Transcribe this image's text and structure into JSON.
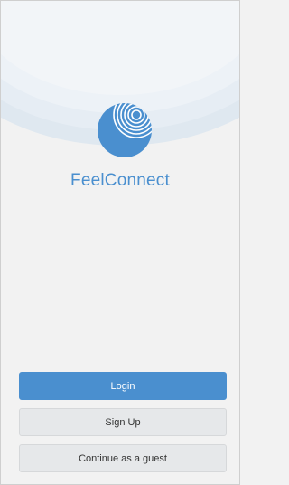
{
  "app": {
    "name": "FeelConnect",
    "logo_icon": "spiral-sphere-logo-icon"
  },
  "actions": {
    "login_label": "Login",
    "signup_label": "Sign Up",
    "guest_label": "Continue as a guest"
  },
  "colors": {
    "accent": "#4a8fcf",
    "background": "#f2f2f2",
    "secondary_button": "#e6e8ea",
    "text": "#333333"
  }
}
